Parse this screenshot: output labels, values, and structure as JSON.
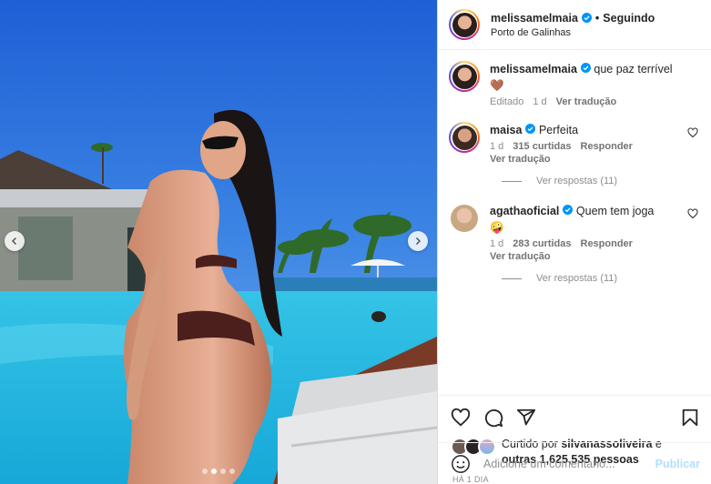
{
  "post": {
    "username": "melissamelmaia",
    "following_label": "Seguindo",
    "location": "Porto de Galinhas"
  },
  "media": {
    "dot_count": 4,
    "active_dot": 1
  },
  "caption": {
    "username": "melissamelmaia",
    "text": "que paz terrível",
    "emoji": "🤎",
    "edited": "Editado",
    "time": "1 d",
    "translate": "Ver tradução"
  },
  "comments": [
    {
      "username": "maisa",
      "text": "Perfeita",
      "time": "1 d",
      "likes": "315 curtidas",
      "reply": "Responder",
      "translate": "Ver tradução",
      "view_replies": "Ver respostas (11)"
    },
    {
      "username": "agathaoficial",
      "text": "Quem tem joga",
      "emoji": "🤪",
      "time": "1 d",
      "likes": "283 curtidas",
      "reply": "Responder",
      "translate": "Ver tradução",
      "view_replies": "Ver respostas (11)"
    }
  ],
  "likes": {
    "prefix": "Curtido por",
    "user": "silvanassoliveira",
    "conj": "e",
    "others": "outras 1,625,535 pessoas"
  },
  "timestamp": "HÁ 1 DIA",
  "composer": {
    "placeholder": "Adicione um comentário...",
    "publish": "Publicar"
  },
  "colors": {
    "verified": "#0095f6",
    "publish_disabled": "#b2dffc",
    "muted": "#8e8e8e"
  }
}
